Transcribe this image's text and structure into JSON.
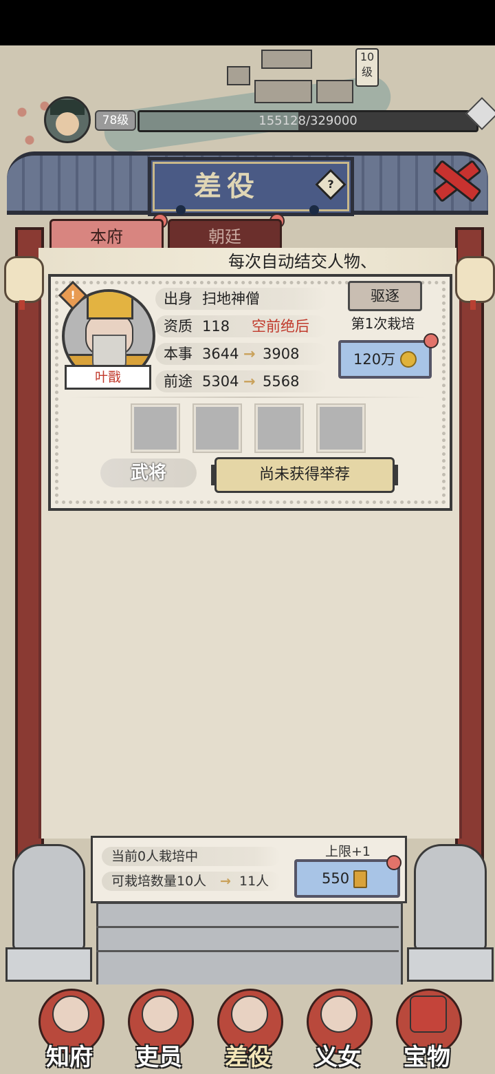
{
  "map": {
    "level_marker": "10级"
  },
  "player": {
    "level": "78级",
    "xp_text": "155128/329000",
    "xp_progress": 0.4715
  },
  "header": {
    "title": "差役",
    "help": "?"
  },
  "tabs": [
    {
      "label": "本府",
      "active": true
    },
    {
      "label": "朝廷",
      "active": false
    }
  ],
  "marquee": "每次自动结交人物、",
  "officer": {
    "name": "叶戬",
    "warn": "!",
    "origin_label": "出身",
    "origin": "扫地神僧",
    "aptitude_label": "资质",
    "aptitude": "118",
    "aptitude_rank": "空前绝后",
    "skill_label": "本事",
    "skill_from": "3644",
    "skill_to": "3908",
    "prospect_label": "前途",
    "prospect_from": "5304",
    "prospect_to": "5568",
    "arrow": "→",
    "role": "武将",
    "recommend": "尚未获得举荐",
    "expel": "驱逐",
    "cultivate_count": "第1次栽培",
    "cultivate_cost": "120万"
  },
  "summary": {
    "current": "当前0人栽培中",
    "capacity_from": "可栽培数量10人",
    "capacity_to": "11人",
    "limit_label": "上限+1",
    "limit_cost": "550"
  },
  "nav": [
    {
      "label": "知府",
      "active": false
    },
    {
      "label": "吏员",
      "active": false
    },
    {
      "label": "差役",
      "active": true
    },
    {
      "label": "义女",
      "active": false
    },
    {
      "label": "宝物",
      "active": false
    }
  ],
  "colors": {
    "accent_red": "#c0392b",
    "panel_bg": "#e4ddcd",
    "pillar": "#8a3a33",
    "blue_button": "#a8c4e6",
    "gold_button": "#e5d6a6"
  }
}
